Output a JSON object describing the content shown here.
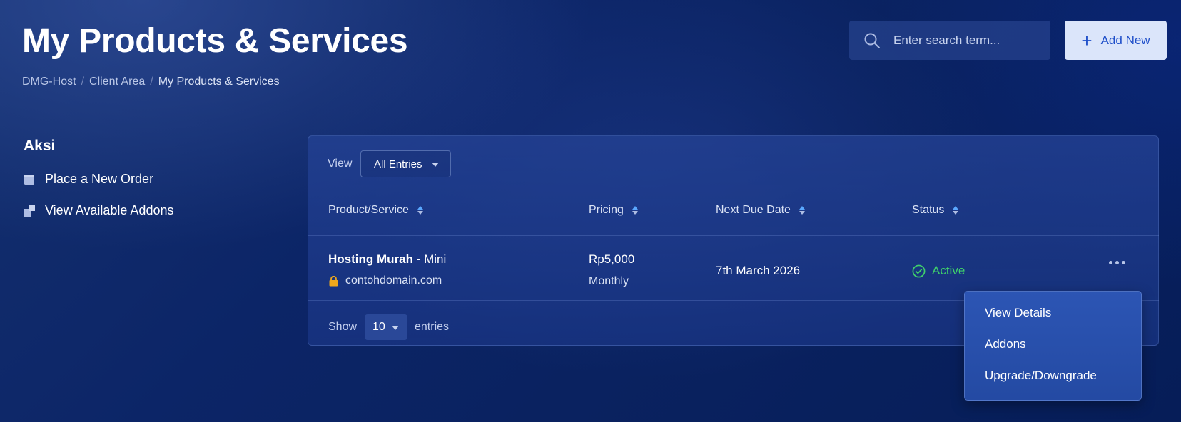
{
  "header": {
    "title": "My Products & Services",
    "breadcrumb": [
      "DMG-Host",
      "Client Area",
      "My Products & Services"
    ],
    "search_placeholder": "Enter search term...",
    "add_new_label": "Add New"
  },
  "sidebar": {
    "title": "Aksi",
    "items": [
      {
        "label": "Place a New Order",
        "icon": "box-icon"
      },
      {
        "label": "View Available Addons",
        "icon": "addons-icon"
      }
    ]
  },
  "table": {
    "view_label": "View",
    "view_selected": "All Entries",
    "columns": [
      "Product/Service",
      "Pricing",
      "Next Due Date",
      "Status"
    ],
    "rows": [
      {
        "product": "Hosting Murah",
        "plan": " - Mini",
        "domain": "contohdomain.com",
        "price": "Rp5,000",
        "cycle": "Monthly",
        "due_date": "7th March 2026",
        "status": "Active"
      }
    ],
    "show_label": "Show",
    "show_value": "10",
    "entries_label": "entries"
  },
  "row_menu": {
    "items": [
      "View Details",
      "Addons",
      "Upgrade/Downgrade"
    ]
  },
  "colors": {
    "accent": "#1f4fc9",
    "status_active": "#3fcf6b",
    "sort_active": "#5aa8ff",
    "lock": "#f0a81c"
  }
}
